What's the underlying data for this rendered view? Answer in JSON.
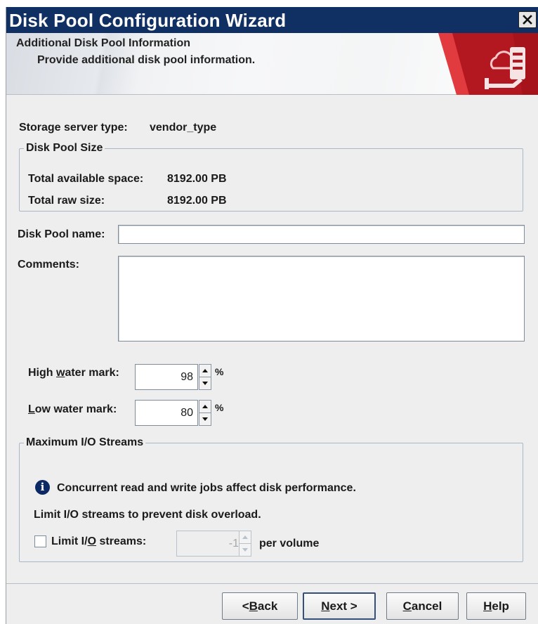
{
  "window": {
    "title": "Disk Pool Configuration Wizard",
    "close_glyph": "✕",
    "colors": {
      "titlebar": "#102f63",
      "accent_red": "#b3171f",
      "info_blue": "#0b2a63"
    }
  },
  "header": {
    "heading": "Additional Disk Pool Information",
    "subtext": "Provide additional disk pool information.",
    "art_icon": "storage-cloud-icon"
  },
  "storage_server": {
    "label": "Storage server type:",
    "value": "vendor_type"
  },
  "disk_pool_size": {
    "legend": "Disk Pool Size",
    "available_label": "Total available space:",
    "available_value": "8192.00 PB",
    "raw_label": "Total raw size:",
    "raw_value": "8192.00 PB"
  },
  "disk_pool_name": {
    "label": "Disk Pool name:",
    "value": ""
  },
  "comments": {
    "label": "Comments:",
    "value": ""
  },
  "high_water": {
    "label_pre": "High ",
    "label_key": "w",
    "label_post": "ater mark:",
    "value": "98",
    "unit": "%"
  },
  "low_water": {
    "label_pre": "",
    "label_key": "L",
    "label_post": "ow water mark:",
    "value": "80",
    "unit": "%"
  },
  "io_streams": {
    "legend": "Maximum I/O Streams",
    "info_text": "Concurrent read and write jobs affect disk performance.",
    "limit_text": "Limit I/O streams to prevent disk overload.",
    "checkbox_pre": "Limit I/",
    "checkbox_key": "O",
    "checkbox_post": " streams:",
    "checked": false,
    "value": "-1",
    "unit": "per volume"
  },
  "buttons": {
    "back": {
      "pre": "< ",
      "key": "B",
      "post": "ack"
    },
    "next": {
      "pre": "",
      "key": "N",
      "post": "ext >"
    },
    "cancel": {
      "pre": "",
      "key": "C",
      "post": "ancel"
    },
    "help": {
      "pre": "",
      "key": "H",
      "post": "elp"
    }
  }
}
